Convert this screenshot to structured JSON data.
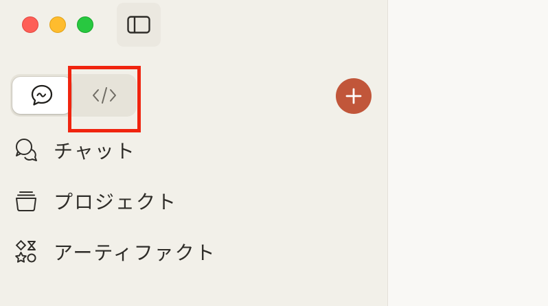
{
  "window": {
    "traffic_lights": [
      "close",
      "minimize",
      "zoom"
    ]
  },
  "toolbar": {
    "sidebar_toggle_icon": "sidebar-icon"
  },
  "mode_switch": {
    "chat_icon": "chat-bubble-icon",
    "code_icon": "code-icon",
    "selected": "chat"
  },
  "new_button": {
    "icon": "plus-icon",
    "color": "#c1563a"
  },
  "nav": {
    "items": [
      {
        "label": "チャット",
        "icon": "chats-icon"
      },
      {
        "label": "プロジェクト",
        "icon": "projects-icon"
      },
      {
        "label": "アーティファクト",
        "icon": "artifacts-icon"
      }
    ]
  },
  "colors": {
    "sidebar_bg": "#f2f0e9",
    "main_bg": "#f9f8f5",
    "highlight": "#f0240f"
  }
}
